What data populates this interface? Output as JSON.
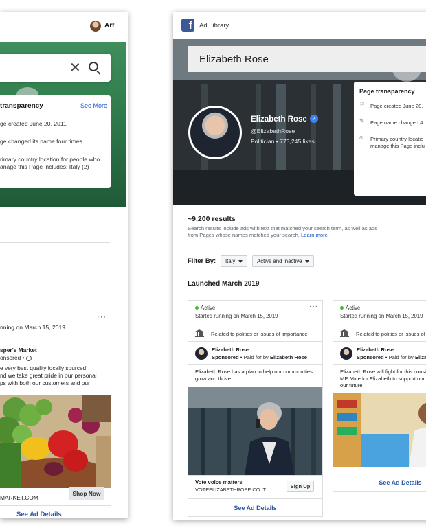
{
  "left": {
    "user_name": "Art",
    "transparency": {
      "title": "transparency",
      "see_more": "See More",
      "created": "ge created June 20, 2011",
      "name_changed": "ge changed its name four times",
      "country_line1": "rimary country location for people who",
      "country_line2": "anage this Page includes: Italy (2)"
    },
    "ad": {
      "menu": "···",
      "started": "nning on March 15, 2019",
      "advertiser": "sper's Market",
      "sponsored": "onsored • ",
      "body_line1": "e very best quality locally sourced",
      "body_line2": "nd we take great pride in our personal",
      "body_line3": "ps with both our customers and our",
      "domain": "MARKET.COM",
      "shop_now": "Shop Now",
      "see_details": "See Ad Details"
    }
  },
  "right": {
    "header_title": "Ad Library",
    "search_query": "Elizabeth Rose",
    "profile": {
      "name": "Elizabeth Rose",
      "handle": "@ElizabethRose",
      "meta": "Politician • 773,245 likes"
    },
    "transparency": {
      "title": "Page transparency",
      "created": "Page created June 20,",
      "name_changed": "Page name changed 4",
      "country_line1": "Primary country locatio",
      "country_line2": "manage this Page inclu"
    },
    "results_count": "~9,200 results",
    "results_note_line1": "Search results include ads with text that matched your search term, as well as ads",
    "results_note_line2": "from Pages whose names matched your search.",
    "learn_more": "Learn more",
    "filter_label": "Filter By:",
    "filter_country": "Italy",
    "filter_status": "Active and Inactive",
    "launched": "Launched March 2019",
    "ads": [
      {
        "status": "Active",
        "menu": "···",
        "started": "Started running on March 15, 2019",
        "related": "Related to politics or issues of importance",
        "advertiser": "Elizabeth Rose",
        "sponsored": "Sponsored",
        "paid_by": " • Paid for by ",
        "payer": "Elizabeth Rose",
        "body_line1": "Elizabeth Rose has a plan to help our communities",
        "body_line2": "grow and thrive.",
        "cta_title": "Vote voice matters",
        "cta_domain": "VOTEELIZABETHROSE.CO.IT",
        "signup": "Sign Up",
        "see_details": "See Ad Details"
      },
      {
        "status": "Active",
        "started": "Started running on March 15, 2019",
        "related": "Related to politics or issues of",
        "advertiser": "Elizabeth Rose",
        "sponsored": "Sponsored",
        "paid_by": " • Paid for by ",
        "payer": "Elizab",
        "body_line1": "Elizabeth Rose will fight for this consi",
        "body_line2": "MP. Vote for Elizabeth to support our",
        "body_line3": "our future.",
        "see_details": "See Ad Details"
      }
    ]
  },
  "colors": {
    "facebook_blue": "#3b5998",
    "link_blue": "#2d5aa8",
    "active_green": "#42b72a",
    "hero_green": "#2f7a4b"
  }
}
